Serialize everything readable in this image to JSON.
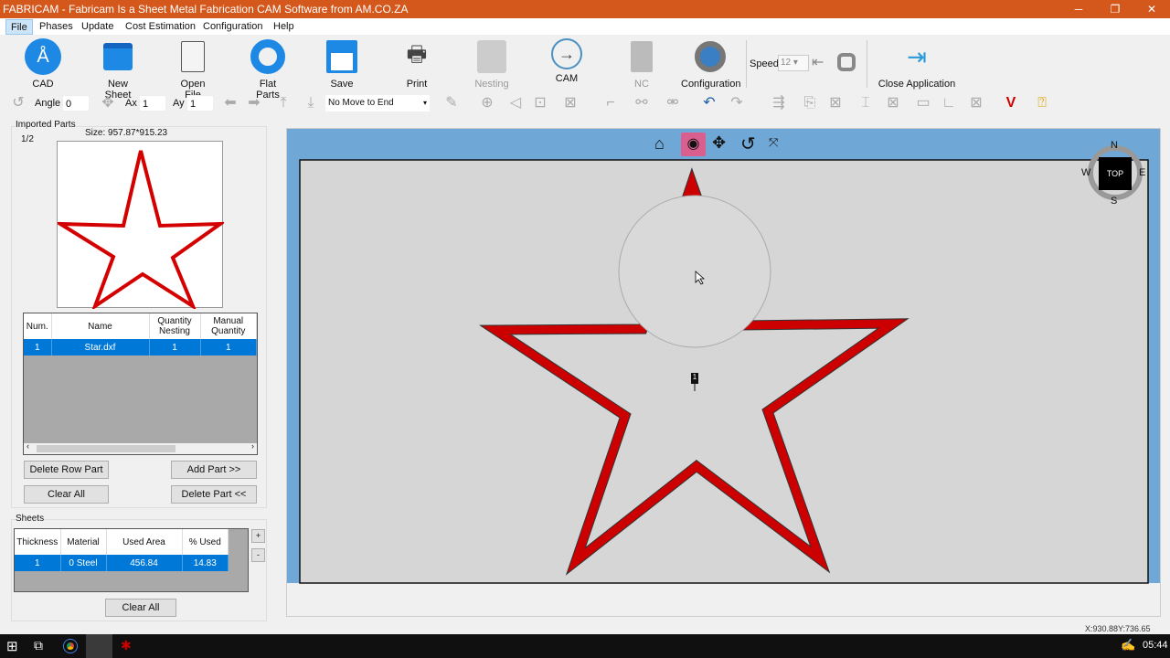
{
  "window": {
    "title": "FABRICAM - Fabricam Is a Sheet Metal Fabrication CAM Software from AM.CO.ZA",
    "minimize": "─",
    "restore": "❐",
    "close": "✕"
  },
  "menu": [
    "File",
    "Phases",
    "Update",
    "Cost Estimation",
    "Configuration",
    "Help"
  ],
  "toolbar": {
    "cad": "CAD",
    "new_sheet": "New Sheet",
    "open_file": "Open File",
    "flat_parts": "Flat Parts",
    "save": "Save",
    "print": "Print",
    "nesting": "Nesting",
    "cam": "CAM",
    "nc": "NC",
    "configuration": "Configuration",
    "speed_label": "Speed",
    "speed_value": "12",
    "close_app": "Close Application"
  },
  "toolbar2": {
    "angle_label": "Angle",
    "angle_value": "0",
    "ax_label": "Ax",
    "ax_value": "1",
    "ay_label": "Ay",
    "ay_value": "1",
    "move_select": "No Move to End"
  },
  "imported": {
    "title": "Imported Parts",
    "page": "1/2",
    "size": "Size: 957.87*915.23",
    "columns": [
      "Num.",
      "Name",
      "Quantity Nesting",
      "Manual Quantity"
    ],
    "rows": [
      [
        "1",
        "Star.dxf",
        "1",
        "1"
      ]
    ]
  },
  "buttons": {
    "delete_row": "Delete Row Part",
    "add_part": "Add Part >>",
    "clear_all": "Clear All",
    "delete_part": "Delete Part <<",
    "sheets_clear": "Clear All",
    "plus": "+",
    "minus": "-"
  },
  "sheets": {
    "title": "Sheets",
    "columns": [
      "Thickness",
      "Material",
      "Used Area",
      "% Used"
    ],
    "rows": [
      [
        "1",
        "0  Steel",
        "456.84",
        "14.83"
      ]
    ]
  },
  "viewcube": {
    "n": "N",
    "s": "S",
    "e": "E",
    "w": "W",
    "top": "TOP"
  },
  "part_label": "1",
  "status": {
    "coords": "X:930.88Y:736.65"
  },
  "taskbar": {
    "time": "05:44"
  },
  "colors": {
    "titlebar": "#d4571b",
    "part": "#cc0000",
    "selection": "#0078d7",
    "canvas_frame": "#6fa8d6"
  }
}
